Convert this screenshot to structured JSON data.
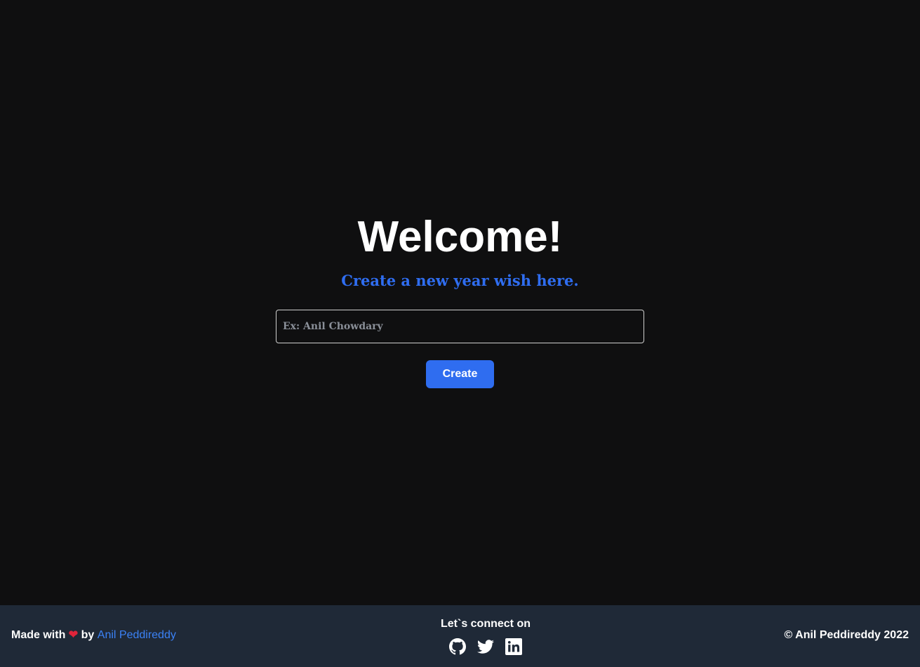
{
  "main": {
    "title": "Welcome!",
    "subtitle": "Create a new year wish here.",
    "name_input": {
      "placeholder": "Ex: Anil Chowdary",
      "value": ""
    },
    "create_label": "Create"
  },
  "footer": {
    "made_with_prefix": "Made with",
    "heart": "❤",
    "by_text": "by",
    "author_link": "Anil Peddireddy",
    "connect_label": "Let`s connect on",
    "socials": [
      {
        "icon": "github-icon"
      },
      {
        "icon": "twitter-icon"
      },
      {
        "icon": "linkedin-icon"
      }
    ],
    "copyright": "© Anil Peddireddy 2022"
  },
  "colors": {
    "background": "#0f0f10",
    "accent": "#2f6df0",
    "footer_bg": "#1f2937",
    "heart": "#e0243a"
  }
}
